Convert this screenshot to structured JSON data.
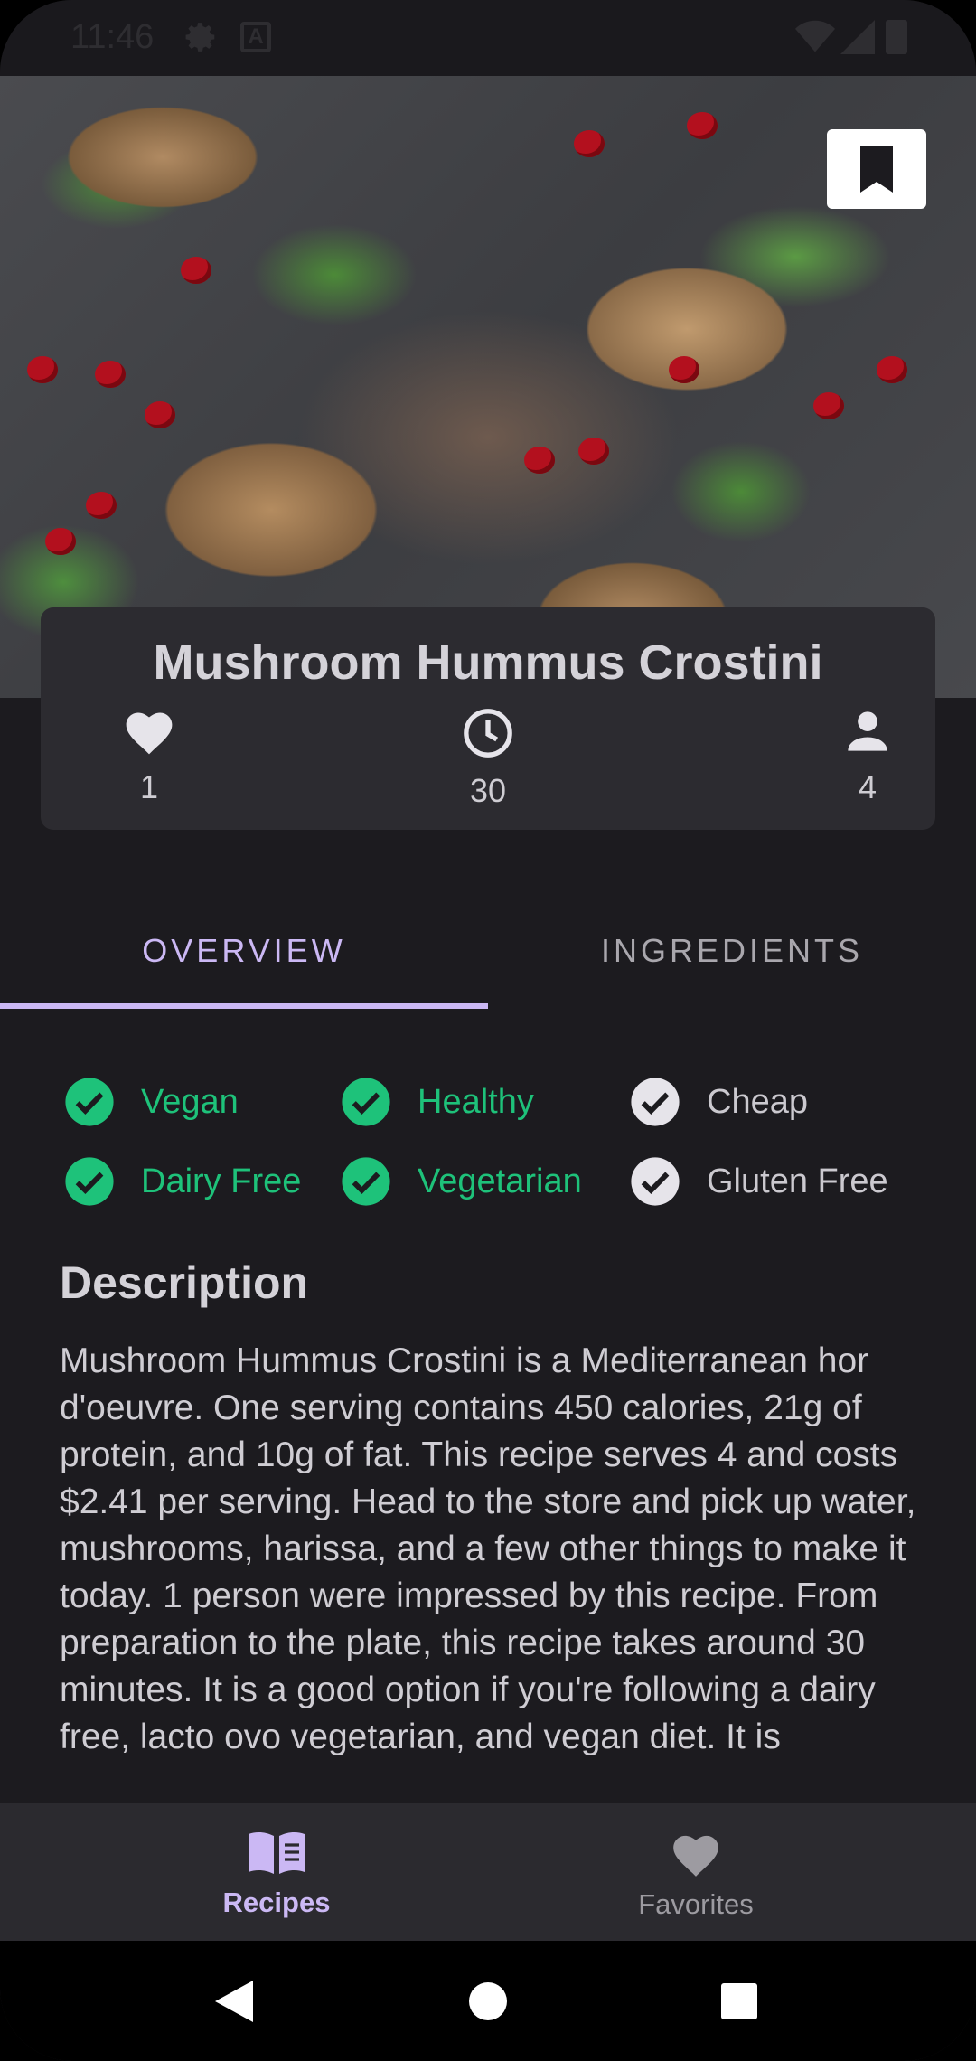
{
  "status_bar": {
    "time": "11:46",
    "icons": [
      "gear-icon",
      "a-icon",
      "wifi-icon",
      "signal-icon",
      "battery-icon"
    ]
  },
  "recipe": {
    "title": "Mushroom Hummus Crostini",
    "likes": "1",
    "minutes": "30",
    "servings": "4",
    "bookmark_icon": "bookmark-icon"
  },
  "tabs": [
    {
      "label": "OVERVIEW",
      "active": true
    },
    {
      "label": "INGREDIENTS",
      "active": false
    }
  ],
  "diet_tags": [
    {
      "label": "Vegan",
      "active": true
    },
    {
      "label": "Healthy",
      "active": true
    },
    {
      "label": "Cheap",
      "active": false
    },
    {
      "label": "Dairy Free",
      "active": true
    },
    {
      "label": "Vegetarian",
      "active": true
    },
    {
      "label": "Gluten Free",
      "active": false
    }
  ],
  "description": {
    "heading": "Description",
    "text": "Mushroom Hummus Crostini is a Mediterranean hor d'oeuvre. One serving contains 450 calories, 21g of protein, and 10g of fat. This recipe serves 4 and costs $2.41 per serving. Head to the store and pick up water, mushrooms, harissa, and a few other things to make it today. 1 person were impressed by this recipe. From preparation to the plate, this recipe takes around 30 minutes. It is a good option if you're following a dairy free, lacto ovo vegetarian, and vegan diet. It is"
  },
  "bottom_nav": [
    {
      "label": "Recipes",
      "icon": "book-icon",
      "active": true
    },
    {
      "label": "Favorites",
      "icon": "heart-icon",
      "active": false
    }
  ],
  "colors": {
    "accent": "#cbb8f4",
    "active_tag": "#1ec27a",
    "background": "#1c1b1f",
    "card": "#2c2b30"
  }
}
